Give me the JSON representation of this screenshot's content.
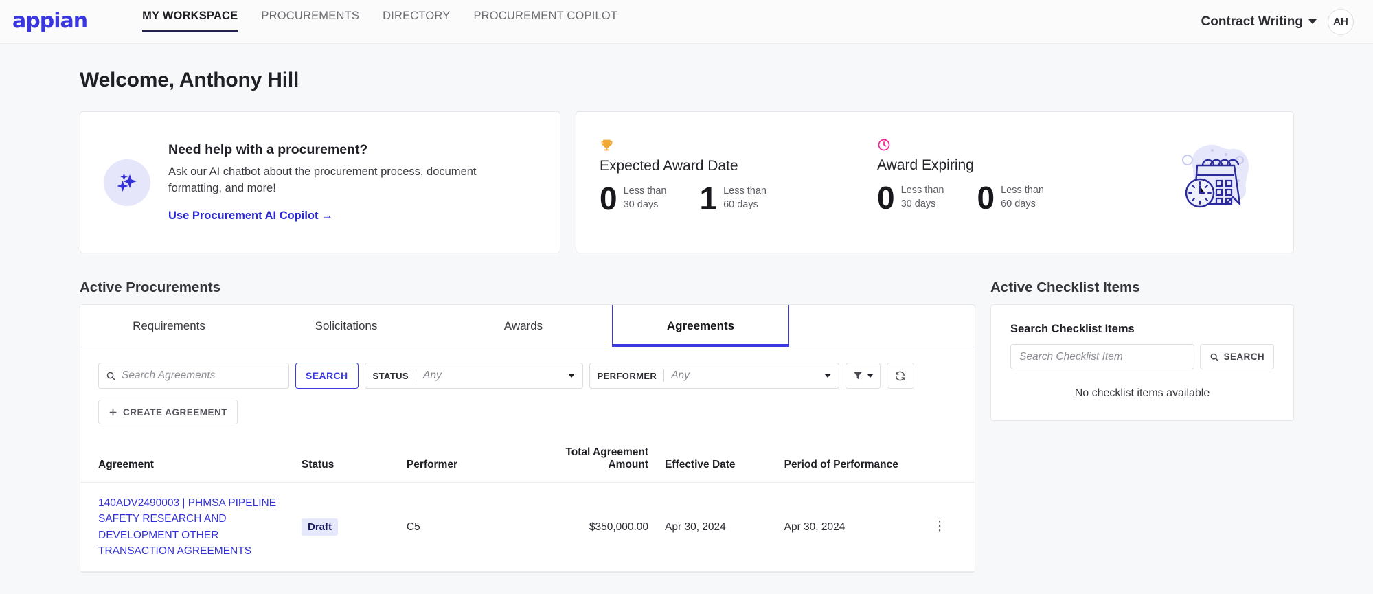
{
  "nav": {
    "logo": "appian",
    "links": [
      {
        "label": "MY WORKSPACE",
        "active": true
      },
      {
        "label": "PROCUREMENTS",
        "active": false
      },
      {
        "label": "DIRECTORY",
        "active": false
      },
      {
        "label": "PROCUREMENT COPILOT",
        "active": false
      }
    ],
    "account": "Contract Writing",
    "avatar_initials": "AH"
  },
  "page": {
    "welcome": "Welcome, Anthony Hill"
  },
  "ai_card": {
    "icon": "sparkles-icon",
    "title": "Need help with a procurement?",
    "description": "Ask our AI chatbot about the procurement process, document formatting, and more!",
    "link": "Use Procurement AI Copilot →"
  },
  "metrics": {
    "illustration": "calendar-clock-illustration",
    "items": [
      {
        "icon": "trophy-icon",
        "icon_color": "#f0a830",
        "title": "Expected Award Date",
        "stats": [
          {
            "value": "0",
            "label_line1": "Less than",
            "label_line2": "30 days"
          },
          {
            "value": "1",
            "label_line1": "Less than",
            "label_line2": "60 days"
          }
        ]
      },
      {
        "icon": "clock-icon",
        "icon_color": "#f51e9b",
        "title": "Award Expiring",
        "stats": [
          {
            "value": "0",
            "label_line1": "Less than",
            "label_line2": "30 days"
          },
          {
            "value": "0",
            "label_line1": "Less than",
            "label_line2": "60 days"
          }
        ]
      }
    ]
  },
  "active_procurements": {
    "title": "Active Procurements",
    "tabs": [
      {
        "label": "Requirements",
        "active": false
      },
      {
        "label": "Solicitations",
        "active": false
      },
      {
        "label": "Awards",
        "active": false
      },
      {
        "label": "Agreements",
        "active": true
      }
    ],
    "toolbar": {
      "search_placeholder": "Search Agreements",
      "search_value": "",
      "search_button": "SEARCH",
      "status_label": "STATUS",
      "status_value": "Any",
      "performer_label": "PERFORMER",
      "performer_value": "Any",
      "filter_icon": "funnel-icon",
      "refresh_icon": "refresh-icon",
      "create_button": "CREATE AGREEMENT"
    },
    "table": {
      "columns": [
        "Agreement",
        "Status",
        "Performer",
        "Total Agreement Amount",
        "Effective Date",
        "Period of Performance",
        ""
      ],
      "rows": [
        {
          "agreement": "140ADV2490003 | PHMSA PIPELINE SAFETY RESEARCH AND DEVELOPMENT OTHER TRANSACTION AGREEMENTS",
          "status": "Draft",
          "performer": "C5",
          "amount": "$350,000.00",
          "effective_date": "Apr 30, 2024",
          "period_of_performance": "Apr 30, 2024",
          "menu": "⋮"
        }
      ]
    }
  },
  "checklist": {
    "title": "Active Checklist Items",
    "search_label": "Search Checklist Items",
    "search_placeholder": "Search Checklist Item",
    "search_value": "",
    "search_button": "SEARCH",
    "empty_message": "No checklist items available"
  },
  "colors": {
    "brand_blue": "#3b39e4",
    "link_blue": "#3330d8",
    "accent_orange": "#f0a830",
    "accent_pink": "#f51e9b",
    "page_bg": "#f7f8fa"
  }
}
